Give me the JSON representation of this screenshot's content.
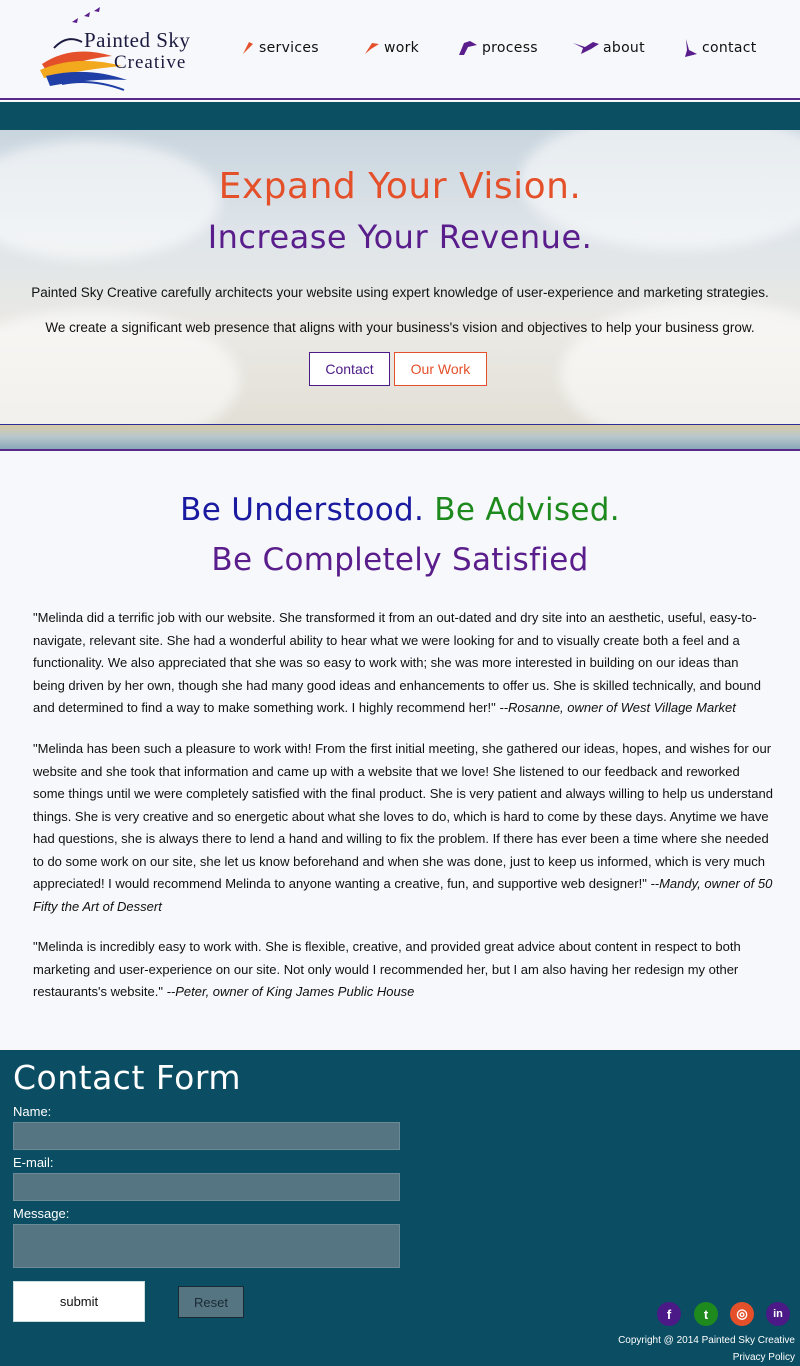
{
  "logo": {
    "line1": "Painted Sky",
    "line2": "Creative"
  },
  "nav": [
    {
      "label": "services",
      "icon": "red-bird-icon"
    },
    {
      "label": "work",
      "icon": "red-bird-icon"
    },
    {
      "label": "process",
      "icon": "purple-bird-icon"
    },
    {
      "label": "about",
      "icon": "purple-bird-icon"
    },
    {
      "label": "contact",
      "icon": "purple-bird-icon"
    }
  ],
  "hero": {
    "headline1": "Expand Your Vision.",
    "headline2": "Increase Your Revenue.",
    "para1": "Painted Sky Creative carefully architects your website using expert knowledge of user-experience and marketing strategies.",
    "para2": "We create a significant web presence that aligns with your business's vision and objectives to help your business grow.",
    "btn_contact": "Contact",
    "btn_work": "Our Work"
  },
  "tagline": {
    "part1": "Be Understood.",
    "part2": "Be Advised.",
    "part3": "Be Completely Satisfied"
  },
  "testimonials": [
    {
      "text": "\"Melinda did a terrific job with our website. She transformed it from an out-dated and dry site into an aesthetic, useful, easy-to-navigate, relevant site. She had a wonderful ability to hear what we were looking for and to visually create both a feel and a functionality. We also appreciated that she was so easy to work with; she was more interested in building on our ideas than being driven by her own, though she had many good ideas and enhancements to offer us. She is skilled technically, and bound and determined to find a way to make something work. I highly recommend her!\"",
      "author": "--Rosanne, owner of West Village Market"
    },
    {
      "text": "\"Melinda has been such a pleasure to work with! From the first initial meeting, she gathered our ideas, hopes, and wishes for our website and she took that information and came up with a website that we love! She listened to our feedback and reworked some things until we were completely satisfied with the final product. She is very patient and always willing to help us understand things. She is very creative and so energetic about what she loves to do, which is hard to come by these days. Anytime we have had questions, she is always there to lend a hand and willing to fix the problem. If there has ever been a time where she needed to do some work on our site, she let us know beforehand and when she was done, just to keep us informed, which is very much appreciated! I would recommend Melinda to anyone wanting a creative, fun, and supportive web designer!\"",
      "author": "--Mandy, owner of 50 Fifty the Art of Dessert"
    },
    {
      "text": "\"Melinda is incredibly easy to work with. She is flexible, creative, and provided great advice about content in respect to both marketing and user-experience on our site. Not only would I recommended her, but I am also having her redesign my other restaurants's website.\"",
      "author": "--Peter, owner of King James Public House"
    }
  ],
  "contact_form": {
    "title": "Contact Form",
    "name_label": "Name:",
    "email_label": "E-mail:",
    "message_label": "Message:",
    "name_value": "",
    "email_value": "",
    "message_value": "",
    "submit_label": "submit",
    "reset_label": "Reset"
  },
  "social": [
    {
      "icon": "facebook-icon",
      "glyph": "f",
      "color": "#4b1a86"
    },
    {
      "icon": "twitter-icon",
      "glyph": "t",
      "color": "#1e8a1e"
    },
    {
      "icon": "instagram-icon",
      "glyph": "◎",
      "color": "#e4502a"
    },
    {
      "icon": "linkedin-icon",
      "glyph": "in",
      "color": "#4b1a86"
    }
  ],
  "footer": {
    "copyright": "Copyright @ 2014 Painted Sky Creative",
    "privacy": "Privacy Policy"
  },
  "colors": {
    "accent_orange": "#e4502a",
    "accent_purple": "#5a1d8c",
    "teal": "#0b4d62"
  }
}
